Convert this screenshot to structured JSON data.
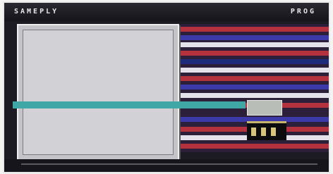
{
  "window": {
    "title_left": "SAMEPLY",
    "title_center": "",
    "title_right": "PROG"
  },
  "dialog": {
    "rows": [
      {
        "k": "",
        "v": ""
      },
      {
        "k": "",
        "v": ""
      },
      {
        "k": "",
        "v": ""
      },
      {
        "k": "",
        "v": ""
      },
      {
        "k": "",
        "v": ""
      },
      {
        "k": "",
        "v": ""
      },
      {
        "k": "",
        "v": ""
      },
      {
        "k": "",
        "v": ""
      },
      {
        "k": "",
        "v": ""
      },
      {
        "k": "",
        "v": ""
      },
      {
        "k": "",
        "v": ""
      },
      {
        "k": "",
        "v": ""
      }
    ],
    "highlight_text": ""
  },
  "status_box": {
    "text": ""
  },
  "colors": {
    "highlight": "#3fa8a6",
    "panel": "#c4c4c8",
    "stripe_red": "#b3323e",
    "stripe_blue": "#3b3aa8"
  }
}
